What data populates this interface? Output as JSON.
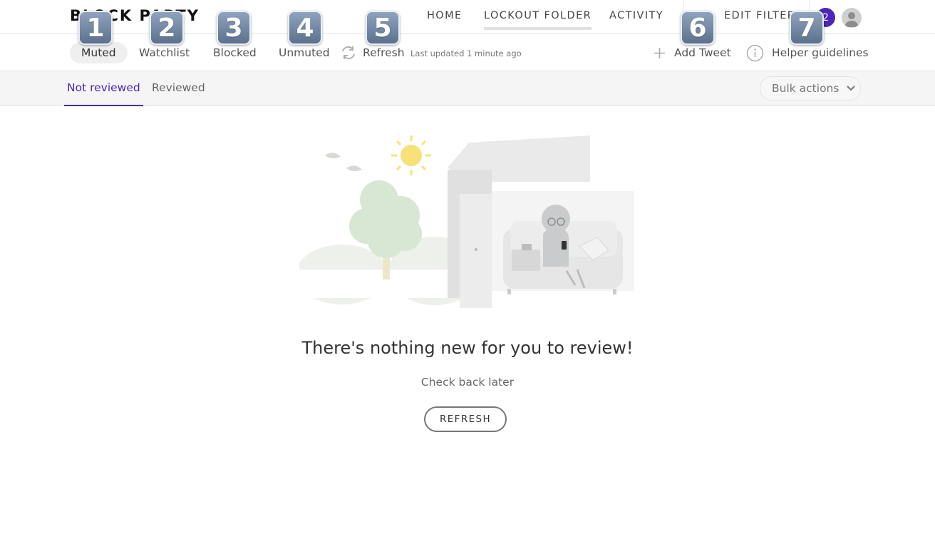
{
  "brand": {
    "logo_text": "BLOCK PARTY"
  },
  "nav": {
    "home": "HOME",
    "lockout_folder": "LOCKOUT FOLDER",
    "activity": "ACTIVITY",
    "edit_filters": "EDIT FILTERS",
    "notification_count": "2"
  },
  "subnav": {
    "muted": "Muted",
    "watchlist": "Watchlist",
    "blocked": "Blocked",
    "unmuted": "Unmuted",
    "refresh": "Refresh",
    "last_updated": "Last updated 1 minute ago",
    "add_tweet": "Add Tweet",
    "helper_guidelines": "Helper guidelines"
  },
  "tabs": {
    "not_reviewed": "Not reviewed",
    "reviewed": "Reviewed",
    "bulk_actions": "Bulk actions"
  },
  "empty_state": {
    "title": "There's nothing new for you to review!",
    "subtitle": "Check back later",
    "refresh_button": "REFRESH"
  },
  "annotations": [
    "1",
    "2",
    "3",
    "4",
    "5",
    "6",
    "7"
  ],
  "colors": {
    "accent": "#4a27b8",
    "badge": "#6b7f9b"
  }
}
